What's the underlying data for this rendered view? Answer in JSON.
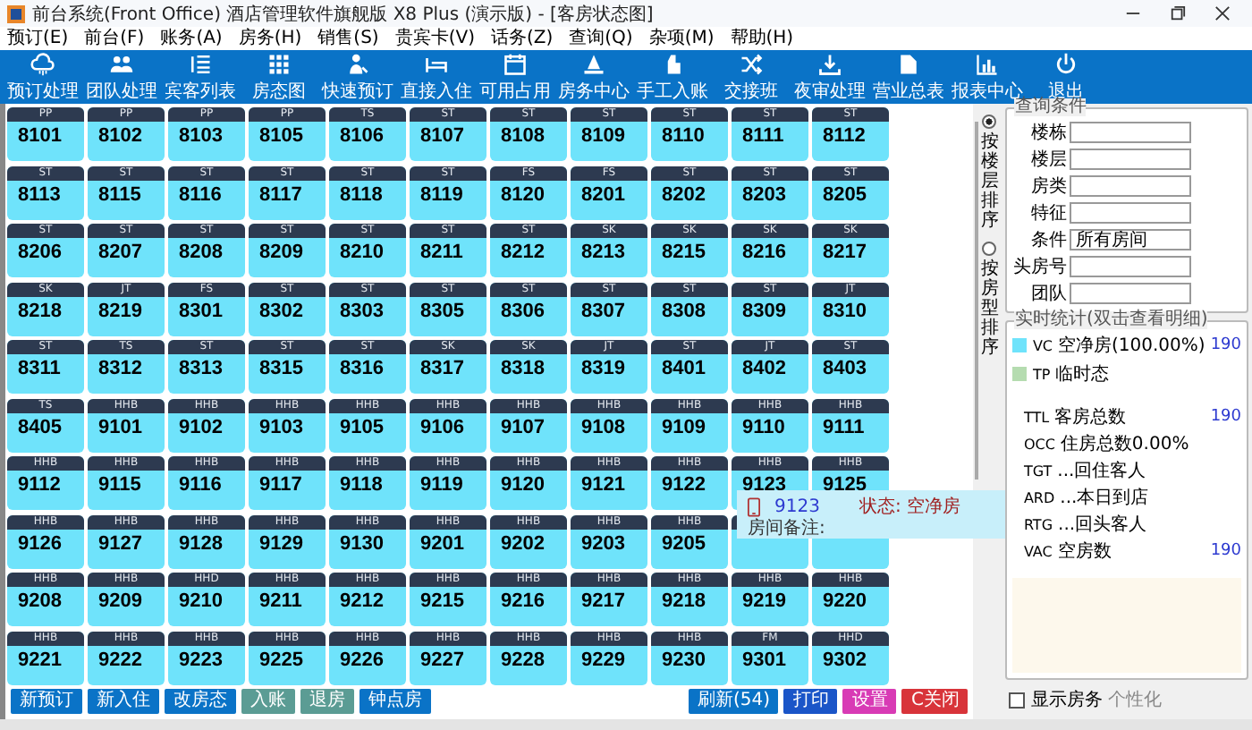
{
  "window": {
    "title": "前台系统(Front Office) 酒店管理软件旗舰版 X8 Plus (演示版) - [客房状态图]"
  },
  "menu": [
    "预订(E)",
    "前台(F)",
    "账务(A)",
    "房务(H)",
    "销售(S)",
    "贵宾卡(V)",
    "话务(Z)",
    "查询(Q)",
    "杂项(M)",
    "帮助(H)"
  ],
  "toolbar": [
    "预订处理",
    "团队处理",
    "宾客列表",
    "房态图",
    "快速预订",
    "直接入住",
    "可用占用",
    "房务中心",
    "手工入账",
    "交接班",
    "夜审处理",
    "营业总表",
    "报表中心",
    "退出"
  ],
  "room_rows": [
    [
      {
        "type": "PP",
        "number": "8101"
      },
      {
        "type": "PP",
        "number": "8102"
      },
      {
        "type": "PP",
        "number": "8103"
      },
      {
        "type": "PP",
        "number": "8105"
      },
      {
        "type": "TS",
        "number": "8106"
      },
      {
        "type": "ST",
        "number": "8107"
      },
      {
        "type": "ST",
        "number": "8108"
      },
      {
        "type": "ST",
        "number": "8109"
      },
      {
        "type": "ST",
        "number": "8110"
      },
      {
        "type": "ST",
        "number": "8111"
      },
      {
        "type": "ST",
        "number": "8112"
      }
    ],
    [
      {
        "type": "ST",
        "number": "8113"
      },
      {
        "type": "ST",
        "number": "8115"
      },
      {
        "type": "ST",
        "number": "8116"
      },
      {
        "type": "ST",
        "number": "8117"
      },
      {
        "type": "ST",
        "number": "8118"
      },
      {
        "type": "ST",
        "number": "8119"
      },
      {
        "type": "FS",
        "number": "8120"
      },
      {
        "type": "FS",
        "number": "8201"
      },
      {
        "type": "ST",
        "number": "8202"
      },
      {
        "type": "ST",
        "number": "8203"
      },
      {
        "type": "ST",
        "number": "8205"
      }
    ],
    [
      {
        "type": "ST",
        "number": "8206"
      },
      {
        "type": "ST",
        "number": "8207"
      },
      {
        "type": "ST",
        "number": "8208"
      },
      {
        "type": "ST",
        "number": "8209"
      },
      {
        "type": "ST",
        "number": "8210"
      },
      {
        "type": "ST",
        "number": "8211"
      },
      {
        "type": "ST",
        "number": "8212"
      },
      {
        "type": "SK",
        "number": "8213"
      },
      {
        "type": "SK",
        "number": "8215"
      },
      {
        "type": "SK",
        "number": "8216"
      },
      {
        "type": "SK",
        "number": "8217"
      }
    ],
    [
      {
        "type": "SK",
        "number": "8218"
      },
      {
        "type": "JT",
        "number": "8219"
      },
      {
        "type": "FS",
        "number": "8301"
      },
      {
        "type": "ST",
        "number": "8302"
      },
      {
        "type": "ST",
        "number": "8303"
      },
      {
        "type": "ST",
        "number": "8305"
      },
      {
        "type": "ST",
        "number": "8306"
      },
      {
        "type": "ST",
        "number": "8307"
      },
      {
        "type": "ST",
        "number": "8308"
      },
      {
        "type": "ST",
        "number": "8309"
      },
      {
        "type": "JT",
        "number": "8310"
      }
    ],
    [
      {
        "type": "ST",
        "number": "8311"
      },
      {
        "type": "TS",
        "number": "8312"
      },
      {
        "type": "ST",
        "number": "8313"
      },
      {
        "type": "ST",
        "number": "8315"
      },
      {
        "type": "ST",
        "number": "8316"
      },
      {
        "type": "SK",
        "number": "8317"
      },
      {
        "type": "SK",
        "number": "8318"
      },
      {
        "type": "JT",
        "number": "8319"
      },
      {
        "type": "ST",
        "number": "8401"
      },
      {
        "type": "JT",
        "number": "8402"
      },
      {
        "type": "ST",
        "number": "8403"
      }
    ],
    [
      {
        "type": "TS",
        "number": "8405"
      },
      {
        "type": "HHB",
        "number": "9101"
      },
      {
        "type": "HHB",
        "number": "9102"
      },
      {
        "type": "HHB",
        "number": "9103"
      },
      {
        "type": "HHB",
        "number": "9105"
      },
      {
        "type": "HHB",
        "number": "9106"
      },
      {
        "type": "HHB",
        "number": "9107"
      },
      {
        "type": "HHB",
        "number": "9108"
      },
      {
        "type": "HHB",
        "number": "9109"
      },
      {
        "type": "HHB",
        "number": "9110"
      },
      {
        "type": "HHB",
        "number": "9111"
      }
    ],
    [
      {
        "type": "HHB",
        "number": "9112"
      },
      {
        "type": "HHB",
        "number": "9115"
      },
      {
        "type": "HHB",
        "number": "9116"
      },
      {
        "type": "HHB",
        "number": "9117"
      },
      {
        "type": "HHB",
        "number": "9118"
      },
      {
        "type": "HHB",
        "number": "9119"
      },
      {
        "type": "HHB",
        "number": "9120"
      },
      {
        "type": "HHB",
        "number": "9121"
      },
      {
        "type": "HHB",
        "number": "9122"
      },
      {
        "type": "HHB",
        "number": "9123"
      },
      {
        "type": "HHB",
        "number": "9125"
      }
    ],
    [
      {
        "type": "HHB",
        "number": "9126"
      },
      {
        "type": "HHB",
        "number": "9127"
      },
      {
        "type": "HHB",
        "number": "9128"
      },
      {
        "type": "HHB",
        "number": "9129"
      },
      {
        "type": "HHB",
        "number": "9130"
      },
      {
        "type": "HHB",
        "number": "9201"
      },
      {
        "type": "HHB",
        "number": "9202"
      },
      {
        "type": "HHB",
        "number": "9203"
      },
      {
        "type": "HHB",
        "number": "9205"
      },
      {},
      {}
    ],
    [
      {
        "type": "HHB",
        "number": "9208"
      },
      {
        "type": "HHB",
        "number": "9209"
      },
      {
        "type": "HHD",
        "number": "9210"
      },
      {
        "type": "HHB",
        "number": "9211"
      },
      {
        "type": "HHB",
        "number": "9212"
      },
      {
        "type": "HHB",
        "number": "9215"
      },
      {
        "type": "HHB",
        "number": "9216"
      },
      {
        "type": "HHB",
        "number": "9217"
      },
      {
        "type": "HHB",
        "number": "9218"
      },
      {
        "type": "HHB",
        "number": "9219"
      },
      {
        "type": "HHB",
        "number": "9220"
      }
    ],
    [
      {
        "type": "HHB",
        "number": "9221"
      },
      {
        "type": "HHB",
        "number": "9222"
      },
      {
        "type": "HHB",
        "number": "9223"
      },
      {
        "type": "HHB",
        "number": "9225"
      },
      {
        "type": "HHB",
        "number": "9226"
      },
      {
        "type": "HHB",
        "number": "9227"
      },
      {
        "type": "HHB",
        "number": "9228"
      },
      {
        "type": "HHB",
        "number": "9229"
      },
      {
        "type": "HHB",
        "number": "9230"
      },
      {
        "type": "FM",
        "number": "9301"
      },
      {
        "type": "HHD",
        "number": "9302"
      }
    ]
  ],
  "tooltip": {
    "room": "9123",
    "status": "状态: 空净房",
    "note_label": "房间备注:"
  },
  "sort_options": [
    {
      "label": "按楼层排序",
      "selected": true
    },
    {
      "label": "按房型排序",
      "selected": false
    }
  ],
  "query": {
    "title": "查询条件",
    "fields": [
      {
        "label": "楼栋"
      },
      {
        "label": "楼层"
      },
      {
        "label": "房类"
      },
      {
        "label": "特征"
      },
      {
        "label": "条件",
        "value": "所有房间"
      },
      {
        "label": "头房号"
      },
      {
        "label": "团队"
      }
    ]
  },
  "stats": {
    "title": "实时统计(双击查看明细)",
    "legend": [
      {
        "code": "VC",
        "label": "空净房(100.00%)",
        "value": "190",
        "color": "#6fe3fb"
      },
      {
        "code": "TP",
        "label": "临时态",
        "color": "#b5dcb0"
      }
    ],
    "summary": [
      {
        "code": "TTL",
        "label": "客房总数",
        "value": "190"
      },
      {
        "code": "OCC",
        "label": "住房总数0.00%"
      },
      {
        "code": "TGT",
        "label": "...回住客人"
      },
      {
        "code": "ARD",
        "label": "...本日到店"
      },
      {
        "code": "RTG",
        "label": "...回头客人"
      },
      {
        "code": "VAC",
        "label": "空房数",
        "value": "190"
      }
    ]
  },
  "bottom_buttons_left": [
    {
      "label": "新预订",
      "kind": "primary"
    },
    {
      "label": "新入住",
      "kind": "primary"
    },
    {
      "label": "改房态",
      "kind": "primary"
    },
    {
      "label": "入账",
      "kind": "muted"
    },
    {
      "label": "退房",
      "kind": "muted"
    },
    {
      "label": "钟点房",
      "kind": "primary"
    }
  ],
  "bottom_buttons_right": [
    {
      "label": "刷新(54)",
      "kind": "primary"
    },
    {
      "label": "打印",
      "kind": "dark"
    },
    {
      "label": "设置",
      "kind": "magenta"
    },
    {
      "label": "C关闭",
      "kind": "danger"
    }
  ],
  "show_housekeeping": {
    "label": "显示房务",
    "checked": false
  },
  "personalize": "个性化"
}
